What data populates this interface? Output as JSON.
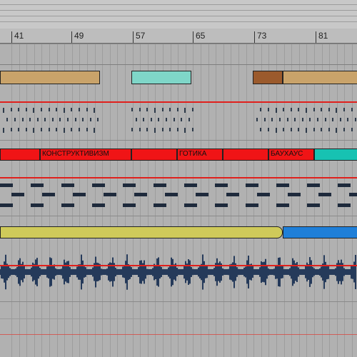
{
  "ruler": {
    "markers": [
      "41",
      "49",
      "57",
      "65",
      "73",
      "81"
    ]
  },
  "tracks": {
    "track1": {
      "clips": [
        {
          "color": "#c9a36a",
          "label": ""
        },
        {
          "color": "#7fd6c8",
          "label": ""
        },
        {
          "color": "#9b5a2c",
          "label": ""
        },
        {
          "color": "#c9a36a",
          "label": ""
        }
      ]
    },
    "track2": {
      "name": "midi-pattern"
    },
    "track3": {
      "clips": [
        {
          "color": "#f01416",
          "label": ""
        },
        {
          "color": "#f01416",
          "label": "КОНСТРУКТИВИЗМ"
        },
        {
          "color": "#f01416",
          "label": ""
        },
        {
          "color": "#f01416",
          "label": "ГОТИКА"
        },
        {
          "color": "#f01416",
          "label": ""
        },
        {
          "color": "#f01416",
          "label": "БАУХАУС"
        },
        {
          "color": "#17c2b2",
          "label": ""
        }
      ]
    },
    "track4": {
      "name": "dash-pattern"
    },
    "track5": {
      "clips": [
        {
          "color": "#cfca5a",
          "label": ""
        },
        {
          "color": "#1f7fd8",
          "label": ""
        }
      ]
    },
    "track6": {
      "name": "audio-waveform"
    }
  },
  "colors": {
    "accent_red": "#e0201c",
    "background": "#a7a7a7"
  }
}
